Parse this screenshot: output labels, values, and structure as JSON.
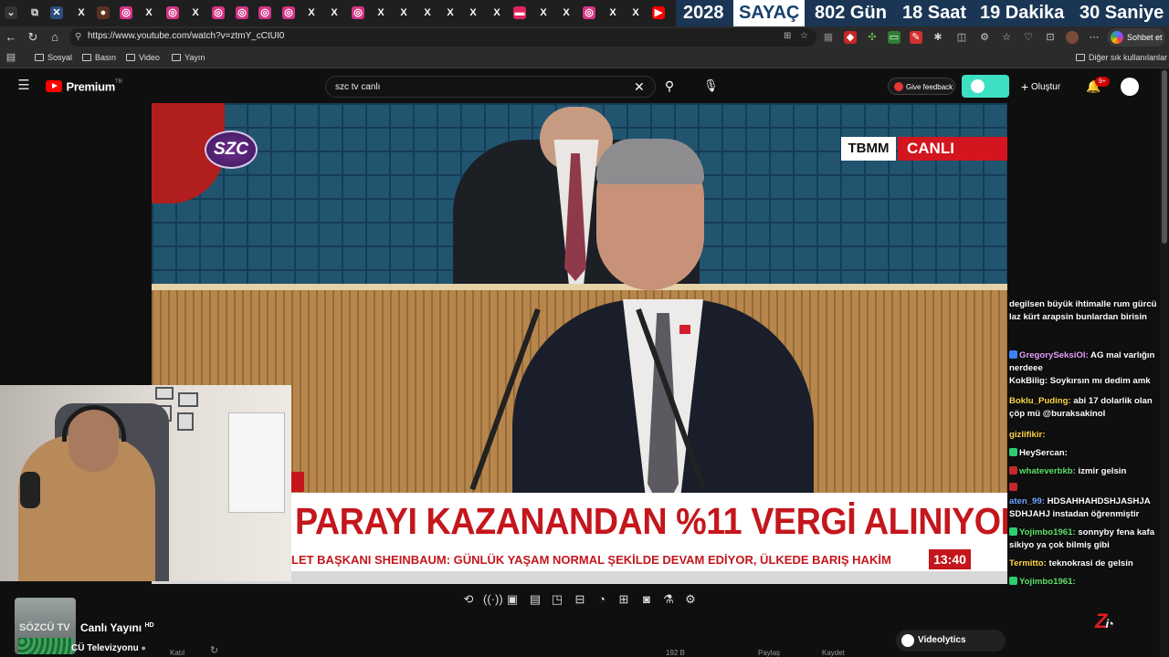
{
  "browser": {
    "url": "https://www.youtube.com/watch?v=ztmY_cCtUI0",
    "counter": {
      "year": "2028",
      "label": "SAYAÇ",
      "days": "802 Gün",
      "hours": "18 Saat",
      "minutes": "19 Dakika",
      "seconds": "30 Saniye"
    },
    "chat_button": "Sohbet et",
    "bookmarks": [
      "Sosyal",
      "Basın",
      "Video",
      "Yayın"
    ],
    "other_bookmarks": "Diğer sık kullanılanlar"
  },
  "youtube": {
    "logo_text": "Premium",
    "logo_region": "TR",
    "search_value": "szc tv canlı",
    "feedback_label": "Give feedback",
    "create_label": "Oluştur",
    "notification_count": "9+"
  },
  "video": {
    "channel_logo": "SZC",
    "tag_left": "TBMM",
    "tag_right": "CANLI",
    "headline": "PARAYI KAZANANDAN %11 VERGİ ALINIYOR\"",
    "ticker": "LET BAŞKANI SHEINBAUM: GÜNLÜK YAŞAM NORMAL ŞEKİLDE DEVAM EDİYOR, ÜLKEDE BARIŞ HAKİM",
    "clock": "13:40"
  },
  "below": {
    "thumb_text": "SÖZCÜ TV",
    "title": "Canlı Yayını",
    "title_badge": "HD",
    "channel": "CÜ Televizyonu",
    "videolytics": "Videolytics",
    "faded_1": "Katıl",
    "faded_2": "192 B",
    "faded_3": "Paylaş",
    "faded_4": "Kaydet"
  },
  "chat": [
    {
      "user": "",
      "text": "degilsen büyük ihtimalle rum gürcü laz kürt arapsin bunlardan birisin",
      "color": "#ffffff"
    },
    {
      "user": "GregorySeksiOl:",
      "text": "AG mal varlığın nerdeee",
      "color": "#e8a0ff"
    },
    {
      "user": "KokBilig:",
      "text": "Soykırsın mı dedim amk",
      "color": "#ffffff"
    },
    {
      "user": "Boklu_Puding:",
      "text": "abi 17 dolarlik olan çöp mü @buraksakinol",
      "color": "#ffd84a"
    },
    {
      "user": "gizlifikir:",
      "text": "",
      "color": "#ffd84a"
    },
    {
      "user": "HeySercan:",
      "text": "",
      "color": "#ffffff"
    },
    {
      "user": "whateverbkb:",
      "text": "izmir gelsin",
      "color": "#5fe36b"
    },
    {
      "user": "",
      "text": "",
      "color": "#ffffff"
    },
    {
      "user": "aten_99:",
      "text": "HDSAHHAHDSHJASHJA SDHJAHJ instadan öğrenmiştir",
      "color": "#6ea8ff"
    },
    {
      "user": "Yojimbo1961:",
      "text": "sonnyby fena kafa sikiyo ya çok bilmiş gibi",
      "color": "#5fe36b"
    },
    {
      "user": "Termitto:",
      "text": "teknokrasi de gelsin",
      "color": "#ffd84a"
    },
    {
      "user": "Yojimbo1961:",
      "text": "",
      "color": "#5fe36b"
    }
  ],
  "colors": {
    "youtube_red": "#ff0000",
    "news_red": "#c4161c",
    "accent_teal": "#3ee0c4",
    "counter_bg": "#1b3655"
  }
}
